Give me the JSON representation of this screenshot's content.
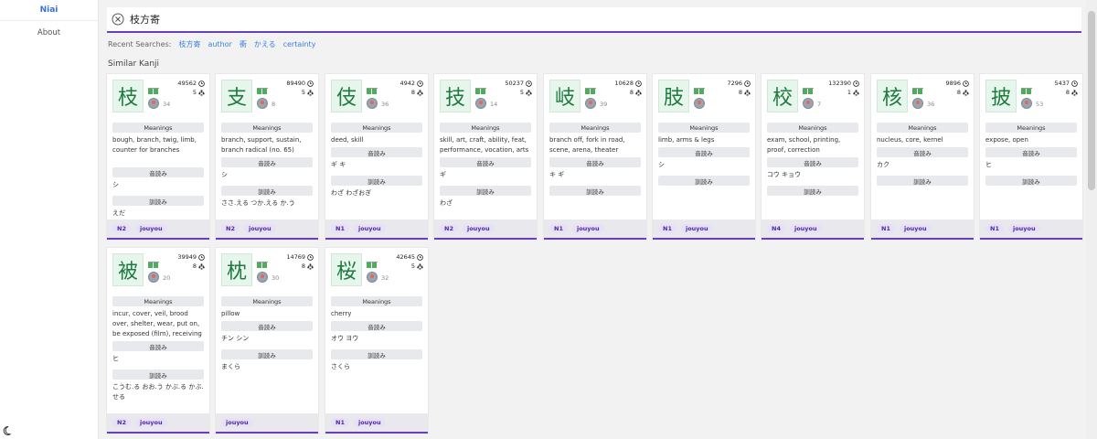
{
  "sidebar": {
    "brand": "Niai",
    "items": [
      {
        "label": "About"
      }
    ]
  },
  "search": {
    "query": "枝方寄"
  },
  "recent": {
    "label": "Recent Searches:",
    "items": [
      "枝方寄",
      "author",
      "衝",
      "かえる",
      "certainty"
    ]
  },
  "section_title": "Similar Kanji",
  "labels": {
    "meanings": "Meanings",
    "on": "音読み",
    "kun": "訓読み"
  },
  "cards": [
    {
      "kanji": "枝",
      "freq": "49562",
      "strokes": "5",
      "sim": "34",
      "meanings": "bough, branch, twig, limb, counter for branches",
      "on": "シ",
      "kun": "えだ",
      "jlpt": "N2",
      "grade": "jouyou"
    },
    {
      "kanji": "支",
      "freq": "89490",
      "strokes": "5",
      "sim": "8",
      "meanings": "branch, support, sustain, branch radical (no. 65)",
      "on": "シ",
      "kun": "ささ.える つか.える か.う",
      "jlpt": "N2",
      "grade": "jouyou"
    },
    {
      "kanji": "伎",
      "freq": "4942",
      "strokes": "8",
      "sim": "36",
      "meanings": "deed, skill",
      "on": "ギ キ",
      "kun": "わざ わざおぎ",
      "jlpt": "N1",
      "grade": "jouyou"
    },
    {
      "kanji": "技",
      "freq": "50237",
      "strokes": "5",
      "sim": "14",
      "meanings": "skill, art, craft, ability, feat, performance, vocation, arts",
      "on": "ギ",
      "kun": "わざ",
      "jlpt": "N2",
      "grade": "jouyou"
    },
    {
      "kanji": "岐",
      "freq": "10628",
      "strokes": "8",
      "sim": "39",
      "meanings": "branch off, fork in road, scene, arena, theater",
      "on": "キ ギ",
      "kun": "",
      "jlpt": "N1",
      "grade": "jouyou"
    },
    {
      "kanji": "肢",
      "freq": "7296",
      "strokes": "8",
      "sim": "",
      "meanings": "limb, arms & legs",
      "on": "シ",
      "kun": "",
      "jlpt": "N1",
      "grade": "jouyou"
    },
    {
      "kanji": "校",
      "freq": "132390",
      "strokes": "1",
      "sim": "7",
      "meanings": "exam, school, printing, proof, correction",
      "on": "コウ キョウ",
      "kun": "",
      "jlpt": "N4",
      "grade": "jouyou"
    },
    {
      "kanji": "核",
      "freq": "9896",
      "strokes": "8",
      "sim": "36",
      "meanings": "nucleus, core, kernel",
      "on": "カク",
      "kun": "",
      "jlpt": "N1",
      "grade": "jouyou"
    },
    {
      "kanji": "披",
      "freq": "5437",
      "strokes": "8",
      "sim": "53",
      "meanings": "expose, open",
      "on": "ヒ",
      "kun": "",
      "jlpt": "N1",
      "grade": "jouyou"
    },
    {
      "kanji": "被",
      "freq": "39949",
      "strokes": "8",
      "sim": "20",
      "meanings": "incur, cover, veil, brood over, shelter, wear, put on, be exposed (film), receiving",
      "on": "ヒ",
      "kun": "こうむ.る おお.う かぶ.る かぶ.せる",
      "jlpt": "N2",
      "grade": "jouyou"
    },
    {
      "kanji": "枕",
      "freq": "14769",
      "strokes": "8",
      "sim": "30",
      "meanings": "pillow",
      "on": "チン シン",
      "kun": "まくら",
      "jlpt": "",
      "grade": "jouyou"
    },
    {
      "kanji": "桜",
      "freq": "42645",
      "strokes": "5",
      "sim": "32",
      "meanings": "cherry",
      "on": "オウ ヨウ",
      "kun": "さくら",
      "jlpt": "N1",
      "grade": "jouyou"
    }
  ],
  "colors": {
    "accent": "#6a3fb8",
    "kanji_bg": "#e7f6ec",
    "kanji_fg": "#1f7a3f",
    "link": "#3b82e0"
  }
}
